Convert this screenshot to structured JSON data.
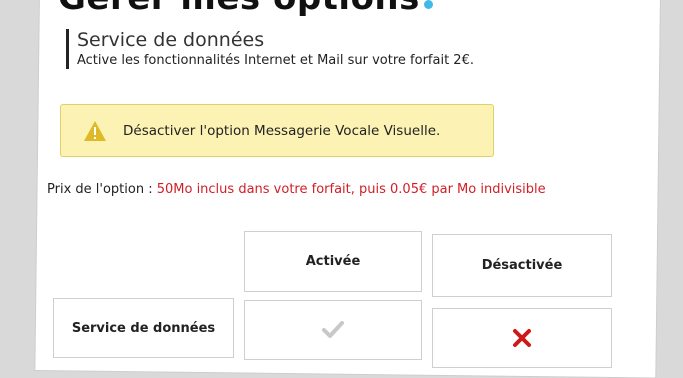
{
  "page": {
    "title": "Gérer mes options"
  },
  "section": {
    "title": "Service de données",
    "description": "Active les fonctionnalités Internet et Mail sur votre forfait 2€."
  },
  "warning": {
    "text": "Désactiver l'option Messagerie Vocale Visuelle.",
    "icon": "warning-triangle-icon",
    "background": "#fbf2b3",
    "icon_color": "#e0b928"
  },
  "price": {
    "label": "Prix de l'option : ",
    "value": "50Mo inclus dans votre forfait, puis 0.05€ par Mo indivisible",
    "value_color": "#d01f26"
  },
  "table": {
    "headers": [
      "Activée",
      "Désactivée"
    ],
    "rows": [
      {
        "label": "Service de données",
        "activee_icon": "check-icon",
        "desactivee_icon": "x-mark-icon"
      }
    ]
  },
  "colors": {
    "accent_dot": "#41b9e8",
    "check_gray": "#c8c8c8",
    "cross_red": "#cc1a1a"
  }
}
